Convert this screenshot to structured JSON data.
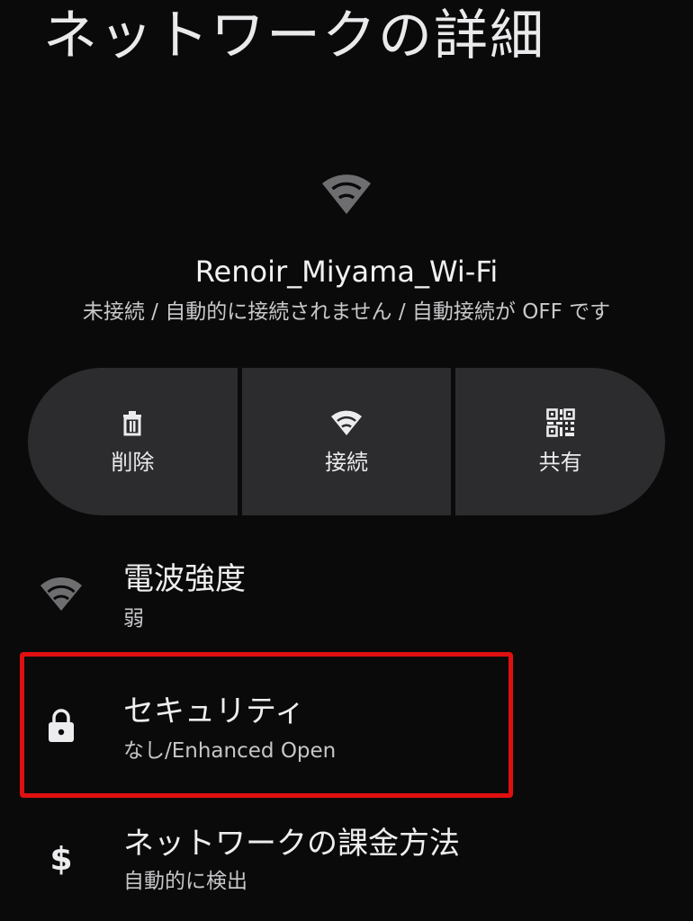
{
  "header": {
    "title": "ネットワークの詳細"
  },
  "network": {
    "icon": "wifi-icon",
    "name": "Renoir_Miyama_Wi-Fi",
    "status": "未接続 / 自動的に接続されません / 自動接続が OFF です"
  },
  "actions": [
    {
      "label": "削除",
      "icon": "trash-icon"
    },
    {
      "label": "接続",
      "icon": "wifi-icon"
    },
    {
      "label": "共有",
      "icon": "qr-code-icon"
    }
  ],
  "details": [
    {
      "title": "電波強度",
      "value": "弱",
      "icon": "signal-weak-icon"
    },
    {
      "title": "セキュリティ",
      "value": "なし/Enhanced Open",
      "icon": "lock-icon"
    },
    {
      "title": "ネットワークの課金方法",
      "value": "自動的に検出",
      "icon": "dollar-icon"
    }
  ],
  "colors": {
    "background": "#0a0a0a",
    "button_surface": "#2c2c2e",
    "highlight": "#e01010",
    "icon_dim": "#6e6e70",
    "icon_bright": "#ececef"
  }
}
